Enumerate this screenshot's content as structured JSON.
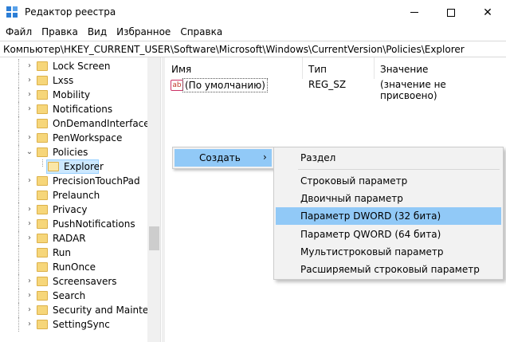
{
  "window": {
    "title": "Редактор реестра",
    "minimize_glyph": "—",
    "close_glyph": "✕"
  },
  "menu": [
    "Файл",
    "Правка",
    "Вид",
    "Избранное",
    "Справка"
  ],
  "address": "Компьютер\\HKEY_CURRENT_USER\\Software\\Microsoft\\Windows\\CurrentVersion\\Policies\\Explorer",
  "tree": {
    "items": [
      {
        "label": "Lock Screen",
        "expanded": false
      },
      {
        "label": "Lxss",
        "expanded": false
      },
      {
        "label": "Mobility",
        "expanded": false
      },
      {
        "label": "Notifications",
        "expanded": false
      },
      {
        "label": "OnDemandInterfaceCa",
        "expanded": null
      },
      {
        "label": "PenWorkspace",
        "expanded": false
      },
      {
        "label": "Policies",
        "expanded": true
      },
      {
        "label": "Explorer",
        "expanded": null
      },
      {
        "label": "PrecisionTouchPad",
        "expanded": false
      },
      {
        "label": "Prelaunch",
        "expanded": null
      },
      {
        "label": "Privacy",
        "expanded": false
      },
      {
        "label": "PushNotifications",
        "expanded": false
      },
      {
        "label": "RADAR",
        "expanded": false
      },
      {
        "label": "Run",
        "expanded": null
      },
      {
        "label": "RunOnce",
        "expanded": null
      },
      {
        "label": "Screensavers",
        "expanded": false
      },
      {
        "label": "Search",
        "expanded": false
      },
      {
        "label": "Security and Maintena",
        "expanded": false
      },
      {
        "label": "SettingSync",
        "expanded": false
      }
    ]
  },
  "list": {
    "columns": {
      "name": "Имя",
      "type": "Тип",
      "value": "Значение"
    },
    "rows": [
      {
        "icon": "ab",
        "name": "(По умолчанию)",
        "type": "REG_SZ",
        "value": "(значение не присвоено)"
      }
    ]
  },
  "context_menu": {
    "create_label": "Создать",
    "arrow": "›"
  },
  "submenu": {
    "key": "Раздел",
    "string": "Строковый параметр",
    "binary": "Двоичный параметр",
    "dword": "Параметр DWORD (32 бита)",
    "qword": "Параметр QWORD (64 бита)",
    "multi": "Мультистроковый параметр",
    "expand": "Расширяемый строковый параметр"
  },
  "colors": {
    "highlight": "#91c9f7",
    "selection": "#cce8ff",
    "folder": "#f6d67a"
  }
}
